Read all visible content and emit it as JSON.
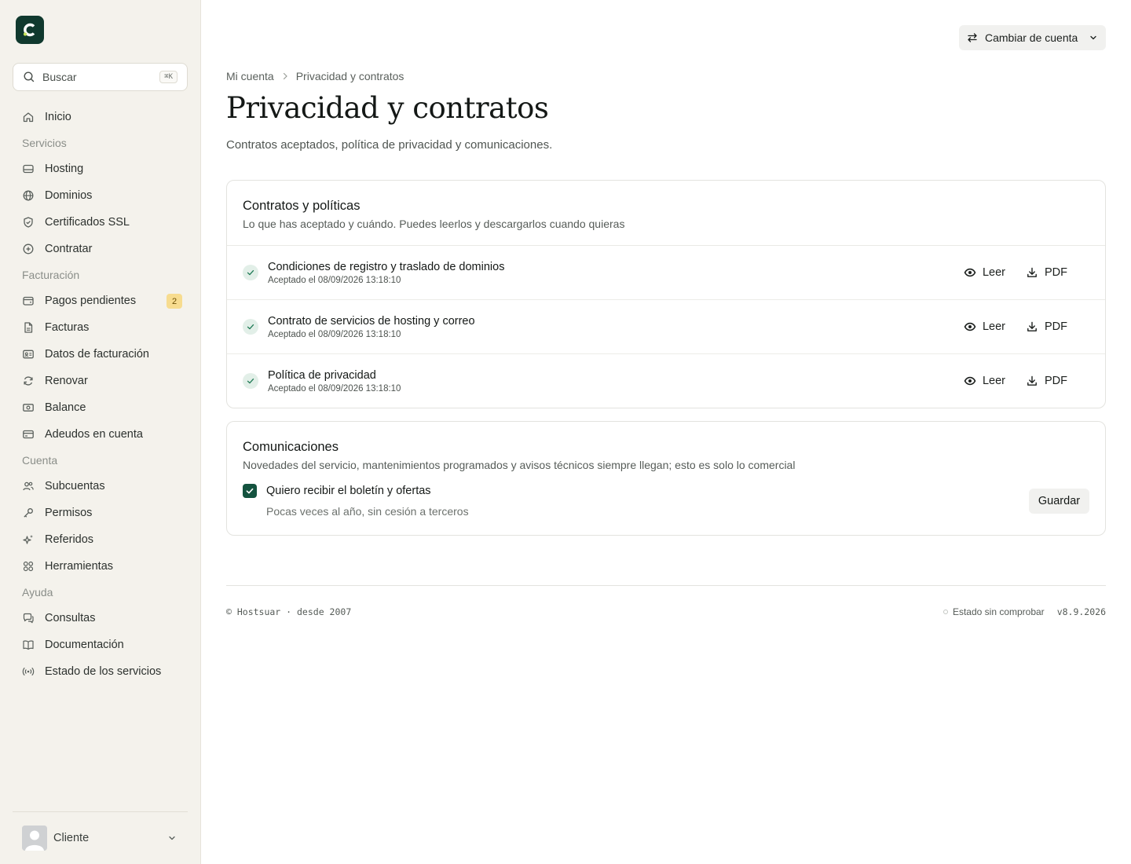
{
  "sidebar": {
    "search": {
      "placeholder": "Buscar",
      "shortcut": "⌘K"
    },
    "home": "Inicio",
    "sections": {
      "services": "Servicios",
      "billing": "Facturación",
      "account": "Cuenta",
      "help": "Ayuda"
    },
    "items": {
      "hosting": "Hosting",
      "domains": "Dominios",
      "ssl": "Certificados SSL",
      "contract": "Contratar",
      "pending": "Pagos pendientes",
      "pending_count": "2",
      "invoices": "Facturas",
      "billing_data": "Datos de facturación",
      "renew": "Renovar",
      "balance": "Balance",
      "debits": "Adeudos en cuenta",
      "subaccounts": "Subcuentas",
      "permissions": "Permisos",
      "referrals": "Referidos",
      "tools": "Herramientas",
      "queries": "Consultas",
      "docs": "Documentación",
      "status": "Estado de los servicios"
    },
    "user": {
      "name": "Cliente"
    }
  },
  "header": {
    "switch_account": "Cambiar de cuenta"
  },
  "breadcrumb": {
    "parent": "Mi cuenta",
    "current": "Privacidad y contratos"
  },
  "page": {
    "title": "Privacidad y contratos",
    "subtitle": "Contratos aceptados, política de privacidad y comunicaciones."
  },
  "contracts": {
    "title": "Contratos y políticas",
    "description": "Lo que has aceptado y cuándo. Puedes leerlos y descargarlos cuando quieras",
    "read_label": "Leer",
    "pdf_label": "PDF",
    "items": [
      {
        "title": "Condiciones de registro y traslado de dominios",
        "date": "Aceptado el 08/09/2026 13:18:10"
      },
      {
        "title": "Contrato de servicios de hosting y correo",
        "date": "Aceptado el 08/09/2026 13:18:10"
      },
      {
        "title": "Política de privacidad",
        "date": "Aceptado el 08/09/2026 13:18:10"
      }
    ]
  },
  "communications": {
    "title": "Comunicaciones",
    "description": "Novedades del servicio, mantenimientos programados y avisos técnicos siempre llegan; esto es solo lo comercial",
    "option_label": "Quiero recibir el boletín y ofertas",
    "option_checked": true,
    "option_hint": "Pocas veces al año, sin cesión a terceros",
    "save_label": "Guardar"
  },
  "footer": {
    "copyright": "© Hostsuar · desde 2007",
    "status": "Estado sin comprobar",
    "version": "v8.9.2026"
  },
  "colors": {
    "brand": "#10392e",
    "brand_accent": "#c6e35a",
    "checkbox": "#14533f",
    "badge_bg": "#f7dc8f",
    "sidebar_bg": "#f4f2ec"
  }
}
